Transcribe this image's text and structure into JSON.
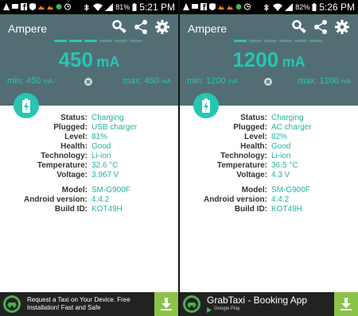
{
  "screens": [
    {
      "status_bar": {
        "battery_percent": "81%",
        "time": "5:21 PM"
      },
      "app": {
        "title": "Ampere"
      },
      "meter": {
        "value": "450",
        "unit": "mA",
        "dashes_lit": 3,
        "dashes_total": 6,
        "min_label": "min:",
        "min_value": "450",
        "max_label": "max:",
        "max_value": "450",
        "mm_unit": "mA"
      },
      "info": [
        {
          "label": "Status:",
          "value": "Charging"
        },
        {
          "label": "Plugged:",
          "value": "USB charger"
        },
        {
          "label": "Level:",
          "value": "81%"
        },
        {
          "label": "Health:",
          "value": "Good"
        },
        {
          "label": "Technology:",
          "value": "Li-ion"
        },
        {
          "label": "Temperature:",
          "value": "32.6 °C"
        },
        {
          "label": "Voltage:",
          "value": "3.967 V"
        }
      ],
      "device": [
        {
          "label": "Model:",
          "value": "SM-G900F"
        },
        {
          "label": "Android version:",
          "value": "4.4.2"
        },
        {
          "label": "Build ID:",
          "value": "KOT49H"
        }
      ],
      "ad": {
        "text": "Request a Taxi on Your Device. Free Installation! Fast and Safe"
      }
    },
    {
      "status_bar": {
        "battery_percent": "82%",
        "time": "5:26 PM"
      },
      "app": {
        "title": "Ampere"
      },
      "meter": {
        "value": "1200",
        "unit": "mA",
        "dashes_lit": 1,
        "dashes_total": 6,
        "min_label": "min:",
        "min_value": "1200",
        "max_label": "max:",
        "max_value": "1200",
        "mm_unit": "mA"
      },
      "info": [
        {
          "label": "Status:",
          "value": "Charging"
        },
        {
          "label": "Plugged:",
          "value": "AC charger"
        },
        {
          "label": "Level:",
          "value": "82%"
        },
        {
          "label": "Health:",
          "value": "Good"
        },
        {
          "label": "Technology:",
          "value": "Li-ion"
        },
        {
          "label": "Temperature:",
          "value": "36.5 °C"
        },
        {
          "label": "Voltage:",
          "value": "4.3 V"
        }
      ],
      "device": [
        {
          "label": "Model:",
          "value": "SM-G900F"
        },
        {
          "label": "Android version:",
          "value": "4.4.2"
        },
        {
          "label": "Build ID:",
          "value": "KOT49H"
        }
      ],
      "ad": {
        "title": "GrabTaxi - Booking App",
        "subtitle": "Google Play"
      }
    }
  ],
  "colors": {
    "accent": "#26c6b5",
    "header": "#526e74",
    "ad_background": "#222222",
    "download_button": "#8bc34a"
  },
  "icons": [
    "key-icon",
    "share-icon",
    "gear-icon",
    "reset-icon",
    "battery-charging-icon",
    "download-icon",
    "taxi-logo-icon",
    "google-play-icon"
  ]
}
